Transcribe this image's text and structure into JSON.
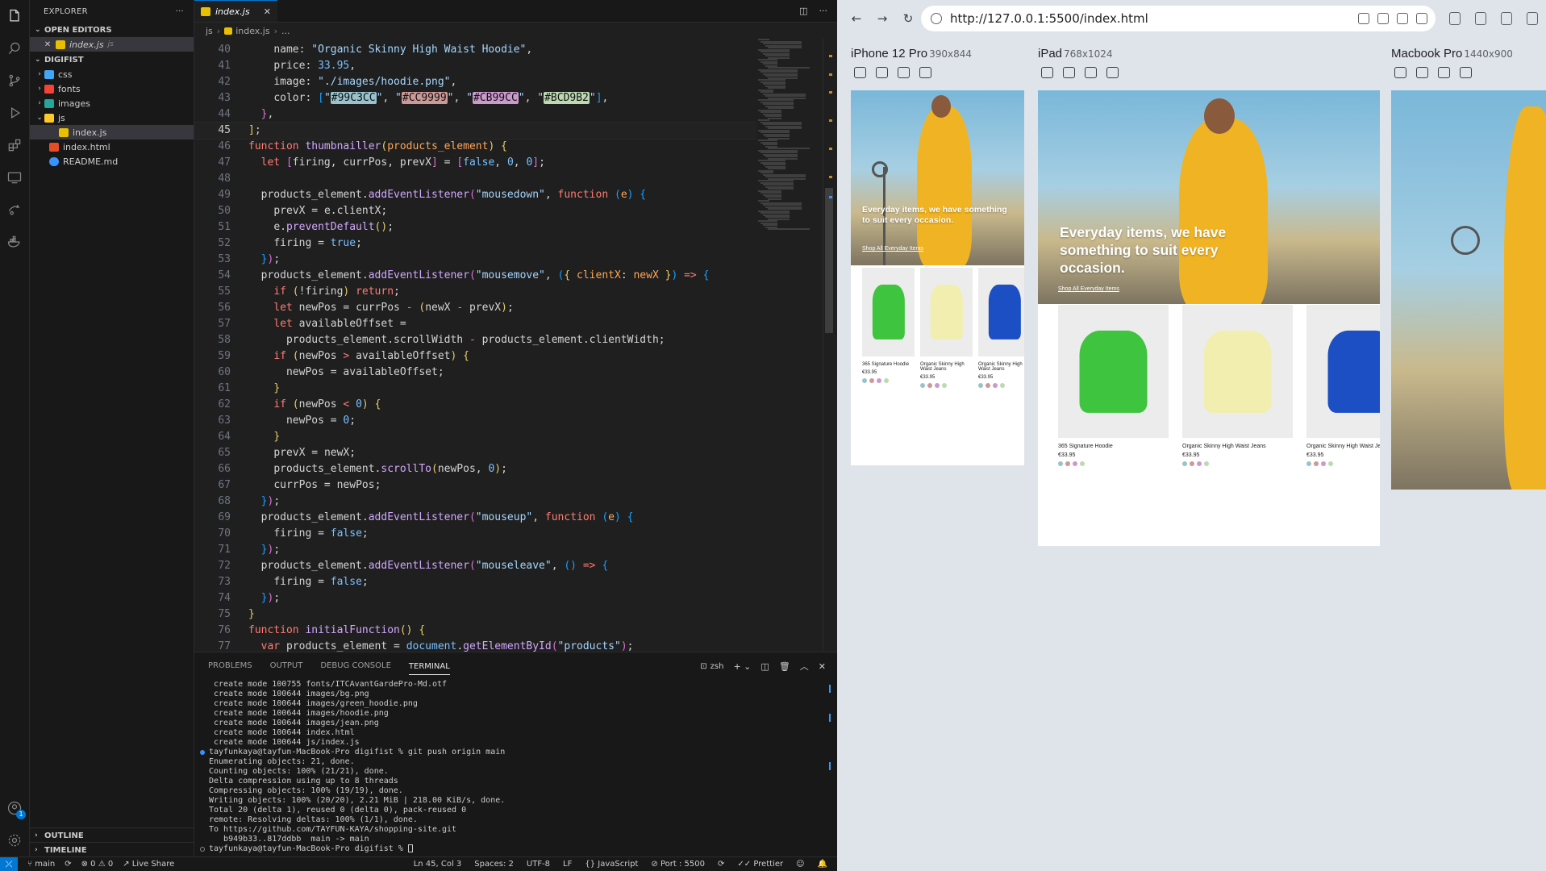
{
  "explorer": {
    "title": "EXPLORER",
    "more": "···",
    "open_editors_label": "OPEN EDITORS",
    "open_editors": [
      {
        "name": "index.js",
        "lang": "js"
      }
    ],
    "project_label": "DIGIFIST",
    "tree": [
      {
        "name": "css",
        "type": "folder",
        "icon": "folder-css"
      },
      {
        "name": "fonts",
        "type": "folder",
        "icon": "folder-fonts"
      },
      {
        "name": "images",
        "type": "folder",
        "icon": "folder-images"
      },
      {
        "name": "js",
        "type": "folder-open",
        "icon": "folder-js"
      },
      {
        "name": "index.js",
        "type": "file",
        "icon": "js"
      },
      {
        "name": "index.html",
        "type": "file",
        "icon": "html"
      },
      {
        "name": "README.md",
        "type": "file",
        "icon": "info"
      }
    ],
    "outline_label": "OUTLINE",
    "timeline_label": "TIMELINE"
  },
  "editor": {
    "tab_label": "index.js",
    "breadcrumb": [
      "js",
      "index.js",
      "..."
    ],
    "current_line": 45,
    "lines": [
      {
        "n": 40,
        "html": "    <span class='p'>name:</span> <span class='s'>\"Organic Skinny High Waist Hoodie\"</span>,"
      },
      {
        "n": 41,
        "html": "    <span class='p'>price:</span> <span class='n'>33.95</span>,"
      },
      {
        "n": 42,
        "html": "    <span class='p'>image:</span> <span class='s'>\"./images/hoodie.png\"</span>,"
      },
      {
        "n": 43,
        "html": "    <span class='p'>color:</span> <span class='br3'>[</span><span class='s'>\"</span><span class='swatch' style='background:#99C3CC'>#99C3CC</span><span class='s'>\"</span>, <span class='s'>\"</span><span class='swatch' style='background:#CC9999'>#CC9999</span><span class='s'>\"</span>, <span class='s'>\"</span><span class='swatch' style='background:#CB99CC'>#CB99CC</span><span class='s'>\"</span>, <span class='s'>\"</span><span class='swatch' style='background:#BCD9B2'>#BCD9B2</span><span class='s'>\"</span><span class='br3'>]</span>,"
      },
      {
        "n": 44,
        "html": "  <span class='br2'>}</span>,"
      },
      {
        "n": 45,
        "html": "<span class='br1'>]</span>;"
      },
      {
        "n": 46,
        "html": "<span class='k'>function</span> <span class='f'>thumbnailler</span><span class='br1'>(</span><span class='v'>products_element</span><span class='br1'>)</span> <span class='br1'>{</span>"
      },
      {
        "n": 47,
        "html": "  <span class='k'>let</span> <span class='br2'>[</span><span class='pr'>firing</span>, <span class='pr'>currPos</span>, <span class='pr'>prevX</span><span class='br2'>]</span> = <span class='br2'>[</span><span class='n'>false</span>, <span class='n'>0</span>, <span class='n'>0</span><span class='br2'>]</span>;"
      },
      {
        "n": 48,
        "html": ""
      },
      {
        "n": 49,
        "html": "  <span class='pr'>products_element</span>.<span class='f'>addEventListener</span><span class='br2'>(</span><span class='s'>\"mousedown\"</span>, <span class='k'>function</span> <span class='br3'>(</span><span class='v'>e</span><span class='br3'>)</span> <span class='br3'>{</span>"
      },
      {
        "n": 50,
        "html": "    <span class='pr'>prevX</span> = <span class='pr'>e</span>.<span class='pr'>clientX</span>;"
      },
      {
        "n": 51,
        "html": "    <span class='pr'>e</span>.<span class='f'>preventDefault</span><span class='br1'>()</span>;"
      },
      {
        "n": 52,
        "html": "    <span class='pr'>firing</span> = <span class='n'>true</span>;"
      },
      {
        "n": 53,
        "html": "  <span class='br3'>}</span><span class='br2'>)</span>;"
      },
      {
        "n": 54,
        "html": "  <span class='pr'>products_element</span>.<span class='f'>addEventListener</span><span class='br2'>(</span><span class='s'>\"mousemove\"</span>, <span class='br3'>(</span><span class='br1'>{</span> <span class='v'>clientX</span>: <span class='v'>newX</span> <span class='br1'>}</span><span class='br3'>)</span> <span class='k'>=&gt;</span> <span class='br3'>{</span>"
      },
      {
        "n": 55,
        "html": "    <span class='k'>if</span> <span class='br1'>(</span>!<span class='pr'>firing</span><span class='br1'>)</span> <span class='k'>return</span>;"
      },
      {
        "n": 56,
        "html": "    <span class='k'>let</span> <span class='pr'>newPos</span> = <span class='pr'>currPos</span> <span class='k'>-</span> <span class='br1'>(</span><span class='pr'>newX</span> <span class='k'>-</span> <span class='pr'>prevX</span><span class='br1'>)</span>;"
      },
      {
        "n": 57,
        "html": "    <span class='k'>let</span> <span class='pr'>availableOffset</span> ="
      },
      {
        "n": 58,
        "html": "      <span class='pr'>products_element</span>.<span class='pr'>scrollWidth</span> <span class='k'>-</span> <span class='pr'>products_element</span>.<span class='pr'>clientWidth</span>;"
      },
      {
        "n": 59,
        "html": "    <span class='k'>if</span> <span class='br1'>(</span><span class='pr'>newPos</span> <span class='k'>&gt;</span> <span class='pr'>availableOffset</span><span class='br1'>)</span> <span class='br1'>{</span>"
      },
      {
        "n": 60,
        "html": "      <span class='pr'>newPos</span> = <span class='pr'>availableOffset</span>;"
      },
      {
        "n": 61,
        "html": "    <span class='br1'>}</span>"
      },
      {
        "n": 62,
        "html": "    <span class='k'>if</span> <span class='br1'>(</span><span class='pr'>newPos</span> <span class='k'>&lt;</span> <span class='n'>0</span><span class='br1'>)</span> <span class='br1'>{</span>"
      },
      {
        "n": 63,
        "html": "      <span class='pr'>newPos</span> = <span class='n'>0</span>;"
      },
      {
        "n": 64,
        "html": "    <span class='br1'>}</span>"
      },
      {
        "n": 65,
        "html": "    <span class='pr'>prevX</span> = <span class='pr'>newX</span>;"
      },
      {
        "n": 66,
        "html": "    <span class='pr'>products_element</span>.<span class='f'>scrollTo</span><span class='br1'>(</span><span class='pr'>newPos</span>, <span class='n'>0</span><span class='br1'>)</span>;"
      },
      {
        "n": 67,
        "html": "    <span class='pr'>currPos</span> = <span class='pr'>newPos</span>;"
      },
      {
        "n": 68,
        "html": "  <span class='br3'>}</span><span class='br2'>)</span>;"
      },
      {
        "n": 69,
        "html": "  <span class='pr'>products_element</span>.<span class='f'>addEventListener</span><span class='br2'>(</span><span class='s'>\"mouseup\"</span>, <span class='k'>function</span> <span class='br3'>(</span><span class='v'>e</span><span class='br3'>)</span> <span class='br3'>{</span>"
      },
      {
        "n": 70,
        "html": "    <span class='pr'>firing</span> = <span class='n'>false</span>;"
      },
      {
        "n": 71,
        "html": "  <span class='br3'>}</span><span class='br2'>)</span>;"
      },
      {
        "n": 72,
        "html": "  <span class='pr'>products_element</span>.<span class='f'>addEventListener</span><span class='br2'>(</span><span class='s'>\"mouseleave\"</span>, <span class='br3'>()</span> <span class='k'>=&gt;</span> <span class='br3'>{</span>"
      },
      {
        "n": 73,
        "html": "    <span class='pr'>firing</span> = <span class='n'>false</span>;"
      },
      {
        "n": 74,
        "html": "  <span class='br3'>}</span><span class='br2'>)</span>;"
      },
      {
        "n": 75,
        "html": "<span class='br1'>}</span>"
      },
      {
        "n": 76,
        "html": "<span class='k'>function</span> <span class='f'>initialFunction</span><span class='br1'>()</span> <span class='br1'>{</span>"
      },
      {
        "n": 77,
        "html": "  <span class='k'>var</span> <span class='pr'>products_element</span> = <span class='n'>document</span>.<span class='f'>getElementById</span><span class='br2'>(</span><span class='s'>\"products\"</span><span class='br2'>)</span>;"
      }
    ]
  },
  "panel": {
    "tabs": [
      "PROBLEMS",
      "OUTPUT",
      "DEBUG CONSOLE",
      "TERMINAL"
    ],
    "active_tab": "TERMINAL",
    "shell": "zsh",
    "terminal_lines": [
      {
        "text": " create mode 100755 fonts/ITCAvantGardePro-Md.otf",
        "dot": ""
      },
      {
        "text": " create mode 100644 images/bg.png",
        "dot": ""
      },
      {
        "text": " create mode 100644 images/green_hoodie.png",
        "dot": ""
      },
      {
        "text": " create mode 100644 images/hoodie.png",
        "dot": ""
      },
      {
        "text": " create mode 100644 images/jean.png",
        "dot": ""
      },
      {
        "text": " create mode 100644 index.html",
        "dot": ""
      },
      {
        "text": " create mode 100644 js/index.js",
        "dot": ""
      },
      {
        "text": "tayfunkaya@tayfun-MacBook-Pro digifist % git push origin main",
        "dot": "blue"
      },
      {
        "text": "Enumerating objects: 21, done.",
        "dot": ""
      },
      {
        "text": "Counting objects: 100% (21/21), done.",
        "dot": ""
      },
      {
        "text": "Delta compression using up to 8 threads",
        "dot": ""
      },
      {
        "text": "Compressing objects: 100% (19/19), done.",
        "dot": ""
      },
      {
        "text": "Writing objects: 100% (20/20), 2.21 MiB | 218.00 KiB/s, done.",
        "dot": ""
      },
      {
        "text": "Total 20 (delta 1), reused 0 (delta 0), pack-reused 0",
        "dot": ""
      },
      {
        "text": "remote: Resolving deltas: 100% (1/1), done.",
        "dot": ""
      },
      {
        "text": "To https://github.com/TAYFUN-KAYA/shopping-site.git",
        "dot": ""
      },
      {
        "text": "   b949b33..817ddbb  main -> main",
        "dot": ""
      },
      {
        "text": "tayfunkaya@tayfun-MacBook-Pro digifist % ",
        "dot": "grey",
        "cursor": true
      }
    ]
  },
  "statusbar": {
    "branch": "main",
    "errors": "0",
    "warnings": "0",
    "live_share": "Live Share",
    "position": "Ln 45, Col 3",
    "spaces": "Spaces: 2",
    "encoding": "UTF-8",
    "eol": "LF",
    "language": "JavaScript",
    "port": "Port : 5500",
    "prettier": "Prettier"
  },
  "browser": {
    "url": "http://127.0.0.1:5500/index.html",
    "devices": [
      {
        "name": "iPhone 12 Pro",
        "size": "390x844"
      },
      {
        "name": "iPad",
        "size": "768x1024"
      },
      {
        "name": "Macbook Pro",
        "size": "1440x900"
      }
    ],
    "site": {
      "hero_heading": "Everyday items, we have something to suit every occasion.",
      "hero_link": "Shop All Everyday Items",
      "products": [
        {
          "name": "365 Signature Hoodie",
          "price": "€33.95",
          "colors": [
            "#99C3CC",
            "#CC9999",
            "#CB99CC",
            "#BCD9B2"
          ],
          "garment": "#3ec43e"
        },
        {
          "name": "Organic Skinny High Waist Jeans",
          "price": "€33.95",
          "colors": [
            "#99C3CC",
            "#CC9999",
            "#CB99CC",
            "#BCD9B2"
          ],
          "garment": "#f2eeb0"
        },
        {
          "name": "Organic Skinny High Waist Jeans",
          "price": "€33.95",
          "colors": [
            "#99C3CC",
            "#CC9999",
            "#CB99CC",
            "#BCD9B2"
          ],
          "garment": "#1d4fc4"
        }
      ]
    }
  }
}
